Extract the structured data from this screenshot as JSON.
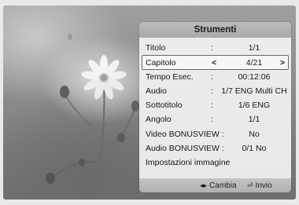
{
  "panel": {
    "title": "Strumenti",
    "rows": [
      {
        "label": "Titolo",
        "value": "1/1"
      },
      {
        "label": "Capitolo",
        "value": "4/21"
      },
      {
        "label": "Tempo Esec.",
        "value": "00:12:06"
      },
      {
        "label": "Audio",
        "value": "1/7 ENG Multi CH"
      },
      {
        "label": "Sottotitolo",
        "value": "1/6 ENG"
      },
      {
        "label": "Angolo",
        "value": "1/1"
      },
      {
        "label": "Video BONUSVIEW :",
        "value": "No"
      },
      {
        "label": "Audio BONUSVIEW :",
        "value": "0/1 No"
      },
      {
        "label": "Impostazioni immagine"
      }
    ],
    "colon": ":",
    "arrow_left": "<",
    "arrow_right": ">"
  },
  "footer": {
    "change_icon": "◂▸",
    "change_label": "Cambia",
    "enter_icon": "⏎",
    "enter_label": "Invio"
  },
  "icons": {
    "change": "left-right-arrows-icon",
    "enter": "enter-icon"
  }
}
